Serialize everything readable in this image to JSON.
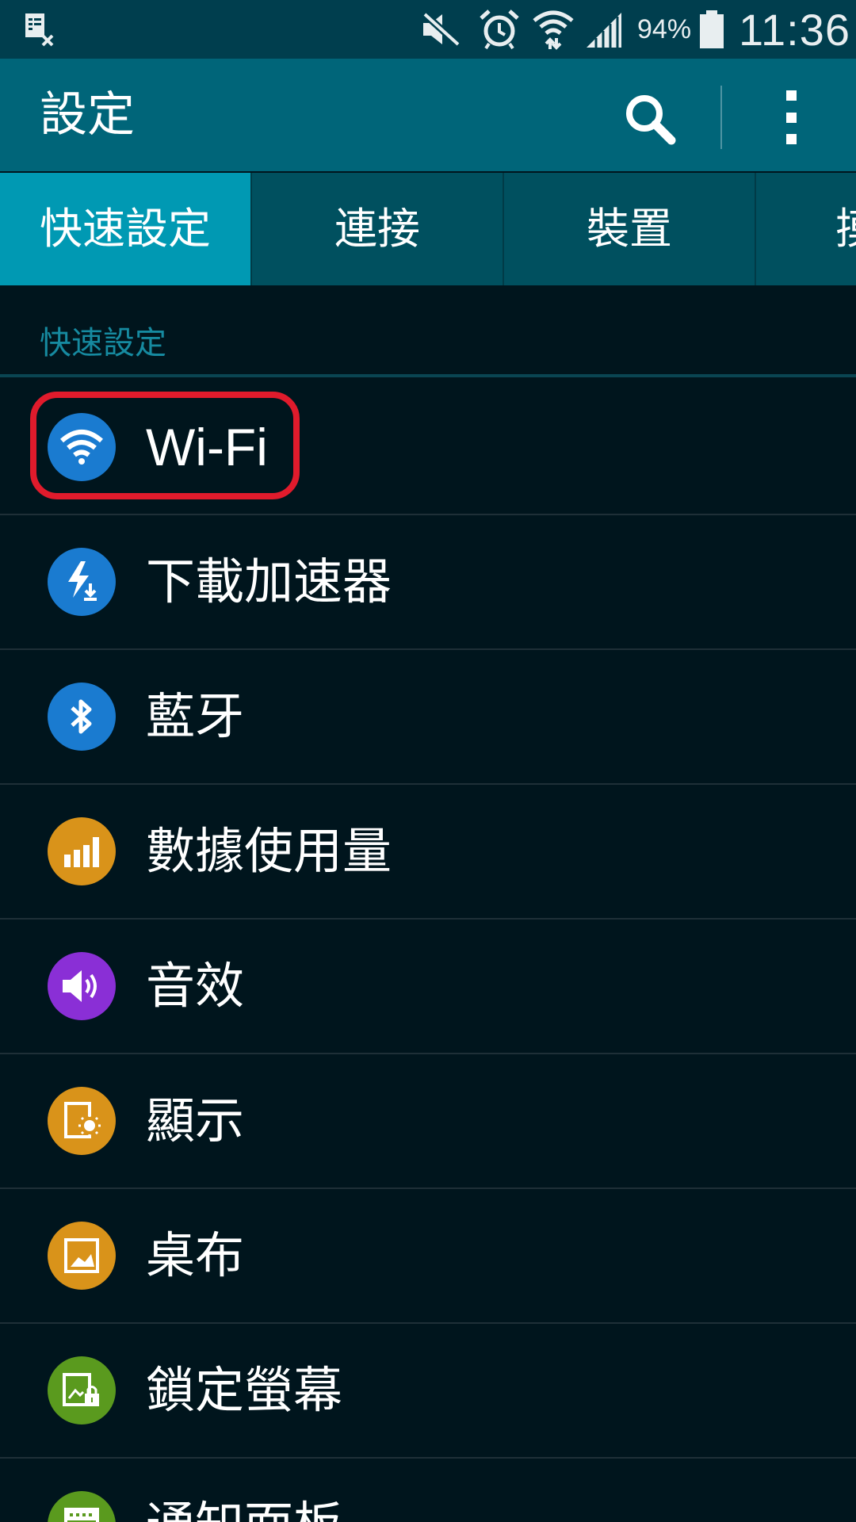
{
  "status_bar": {
    "battery_percent": "94%",
    "time": "11:36",
    "icons": [
      "notes-off-icon",
      "vibrate-mute-icon",
      "alarm-icon",
      "wifi-data-icon",
      "signal-icon",
      "battery-icon"
    ]
  },
  "app_bar": {
    "title": "設定",
    "actions": [
      "search-icon",
      "overflow-menu-icon"
    ]
  },
  "tabs": [
    {
      "label": "快速設定",
      "active": true
    },
    {
      "label": "連接",
      "active": false
    },
    {
      "label": "裝置",
      "active": false
    },
    {
      "label": "摸",
      "active": false
    }
  ],
  "section": {
    "title": "快速設定"
  },
  "items": [
    {
      "label": "Wi-Fi",
      "icon": "wifi-icon",
      "color": "#1a7bd0",
      "highlighted": true
    },
    {
      "label": "下載加速器",
      "icon": "download-booster-icon",
      "color": "#1a7bd0"
    },
    {
      "label": "藍牙",
      "icon": "bluetooth-icon",
      "color": "#1a7bd0"
    },
    {
      "label": "數據使用量",
      "icon": "data-usage-icon",
      "color": "#d9931a"
    },
    {
      "label": "音效",
      "icon": "sound-icon",
      "color": "#8a2fd6"
    },
    {
      "label": "顯示",
      "icon": "display-icon",
      "color": "#d9931a"
    },
    {
      "label": "桌布",
      "icon": "wallpaper-icon",
      "color": "#d9931a"
    },
    {
      "label": "鎖定螢幕",
      "icon": "lock-screen-icon",
      "color": "#5a9a1e"
    },
    {
      "label": "通知面板",
      "icon": "notification-panel-icon",
      "color": "#5a9a1e"
    }
  ],
  "colors": {
    "status_bar": "#003e4e",
    "app_bar": "#006579",
    "tab_active": "#0099b3",
    "tab_inactive": "#00505f",
    "background": "#00151d",
    "section_text": "#168aa0",
    "highlight": "#e01b2c"
  }
}
